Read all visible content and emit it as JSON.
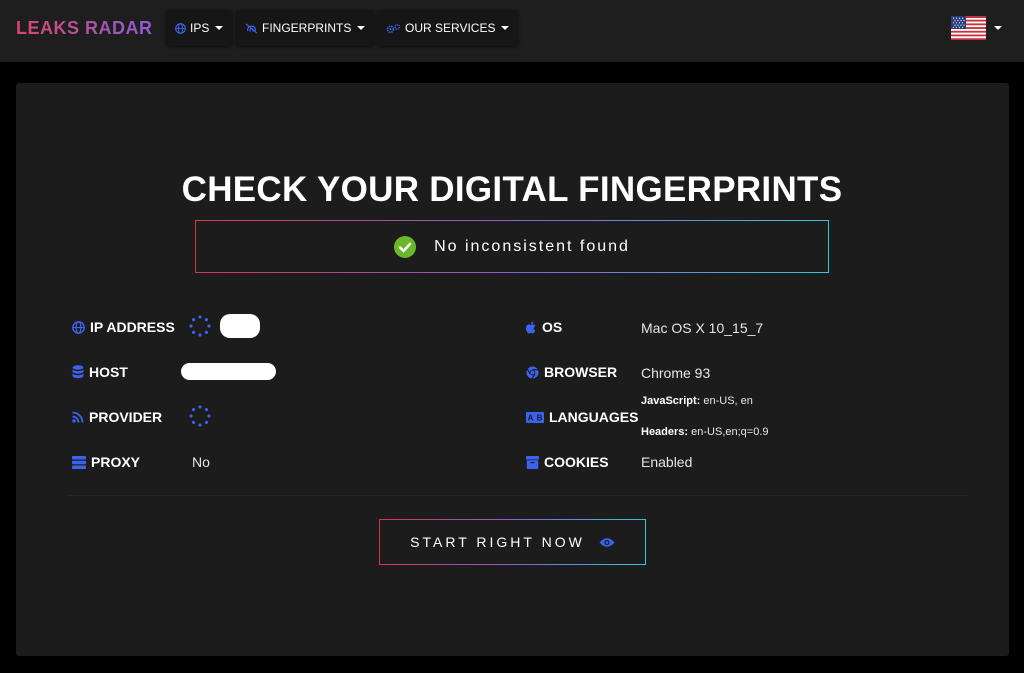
{
  "brand": "LEAKS RADAR",
  "nav": {
    "items": [
      {
        "label": "IPS",
        "icon": "globe-icon"
      },
      {
        "label": "FINGERPRINTS",
        "icon": "fingerprint-icon"
      },
      {
        "label": "OUR SERVICES",
        "icon": "gears-icon"
      }
    ],
    "language_flag": "us-flag-icon"
  },
  "main": {
    "title": "CHECK YOUR DIGITAL FINGERPRINTS",
    "status": "No inconsistent found",
    "left_fields": [
      {
        "label": "IP ADDRESS",
        "icon": "globe-icon",
        "value": ""
      },
      {
        "label": "HOST",
        "icon": "database-icon",
        "value": ""
      },
      {
        "label": "PROVIDER",
        "icon": "rss-icon",
        "value": ""
      },
      {
        "label": "PROXY",
        "icon": "server-icon",
        "value": "No"
      }
    ],
    "right_fields": [
      {
        "label": "OS",
        "icon": "apple-icon",
        "value": "Mac OS X 10_15_7"
      },
      {
        "label": "BROWSER",
        "icon": "chrome-icon",
        "value": "Chrome 93"
      },
      {
        "label": "LANGUAGES",
        "icon": "language-icon",
        "js_label": "JavaScript:",
        "js_value": "en-US, en",
        "headers_label": "Headers:",
        "headers_value": "en-US,en;q=0.9"
      },
      {
        "label": "COOKIES",
        "icon": "archive-icon",
        "value": "Enabled"
      }
    ],
    "cta_label": "START RIGHT NOW"
  },
  "colors": {
    "accent_blue": "#3b63f0",
    "success_green": "#6ab82a",
    "gradient_start": "#d8344f",
    "gradient_end": "#36c5e0"
  }
}
